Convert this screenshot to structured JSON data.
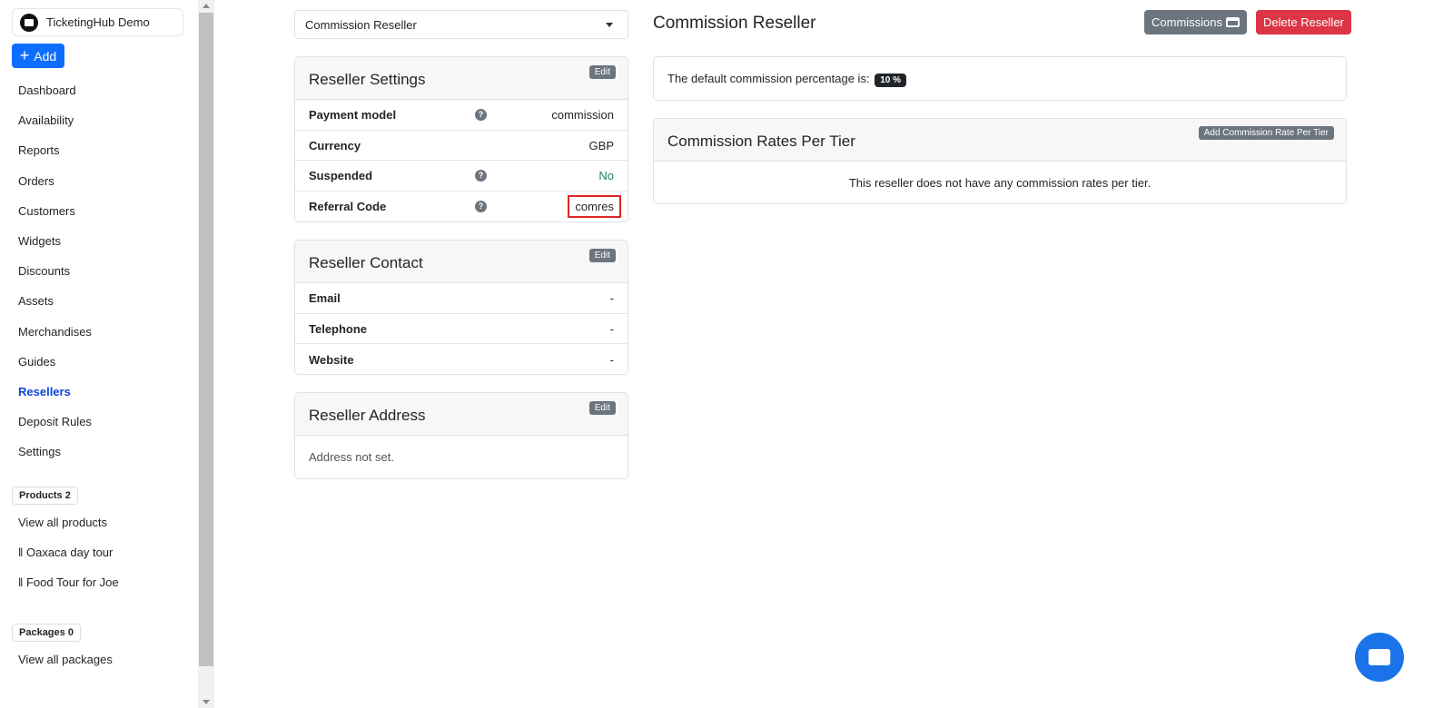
{
  "sidebar": {
    "brand": "TicketingHub Demo",
    "add": "Add",
    "items": [
      "Dashboard",
      "Availability",
      "Reports",
      "Orders",
      "Customers",
      "Widgets",
      "Discounts",
      "Assets",
      "Merchandises",
      "Guides",
      "Resellers",
      "Deposit Rules",
      "Settings"
    ],
    "active": "Resellers",
    "products_badge": "Products 2",
    "view_products": "View all products",
    "products": [
      "Oaxaca day tour",
      "Food Tour for Joe"
    ],
    "packages_badge": "Packages 0",
    "view_packages": "View all packages"
  },
  "selector": {
    "value": "Commission Reseller"
  },
  "settings": {
    "title": "Reseller Settings",
    "edit": "Edit",
    "rows": [
      {
        "label": "Payment model",
        "value": "commission"
      },
      {
        "label": "Currency",
        "value": "GBP"
      },
      {
        "label": "Suspended",
        "value": "No"
      },
      {
        "label": "Referral Code",
        "value": "comres"
      }
    ]
  },
  "contact": {
    "title": "Reseller Contact",
    "edit": "Edit",
    "rows": [
      {
        "label": "Email",
        "value": "-"
      },
      {
        "label": "Telephone",
        "value": "-"
      },
      {
        "label": "Website",
        "value": "-"
      }
    ]
  },
  "address": {
    "title": "Reseller Address",
    "edit": "Edit",
    "body": "Address not set."
  },
  "main": {
    "title": "Commission Reseller",
    "commissions": "Commissions",
    "delete": "Delete Reseller",
    "default_text": "The default commission percentage is:",
    "default_value": "10 %",
    "tiers_title": "Commission Rates Per Tier",
    "add_tier": "Add Commission Rate Per Tier",
    "tiers_empty": "This reseller does not have any commission rates per tier."
  },
  "colors": {
    "primary": "#0d6efd",
    "danger": "#dc3545",
    "secondary": "#6c757d",
    "success": "#198754"
  }
}
